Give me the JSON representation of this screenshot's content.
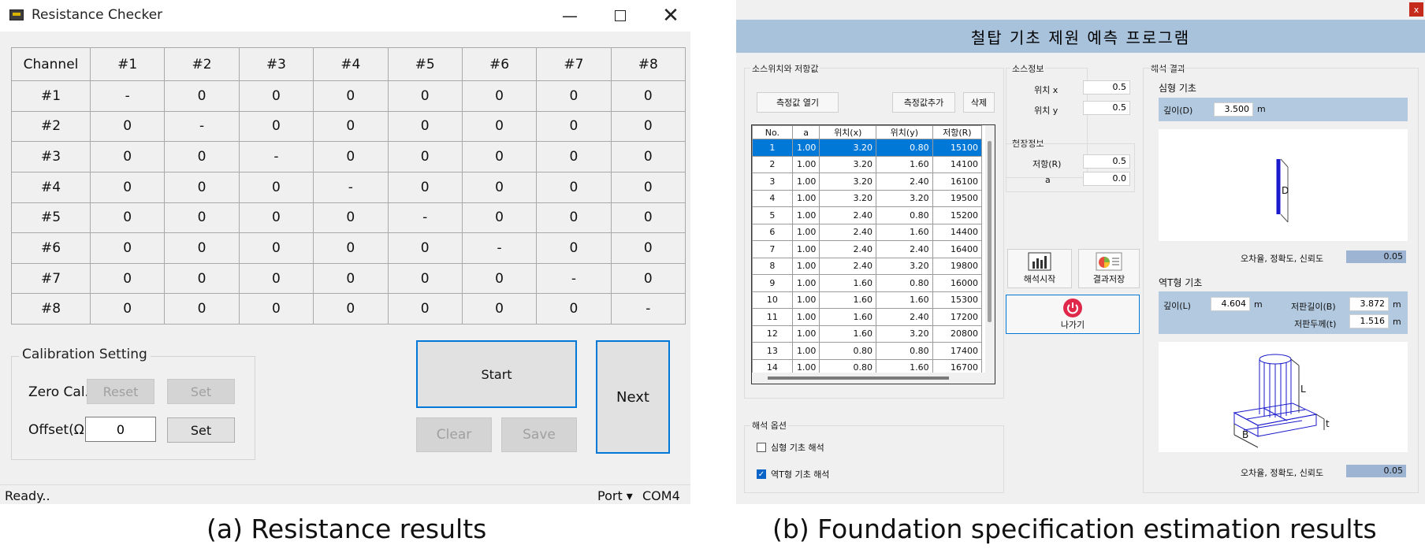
{
  "left": {
    "title": "Resistance Checker",
    "grid": {
      "headers": [
        "Channel",
        "#1",
        "#2",
        "#3",
        "#4",
        "#5",
        "#6",
        "#7",
        "#8"
      ],
      "rows": [
        [
          "#1",
          "-",
          "0",
          "0",
          "0",
          "0",
          "0",
          "0",
          "0"
        ],
        [
          "#2",
          "0",
          "-",
          "0",
          "0",
          "0",
          "0",
          "0",
          "0"
        ],
        [
          "#3",
          "0",
          "0",
          "-",
          "0",
          "0",
          "0",
          "0",
          "0"
        ],
        [
          "#4",
          "0",
          "0",
          "0",
          "-",
          "0",
          "0",
          "0",
          "0"
        ],
        [
          "#5",
          "0",
          "0",
          "0",
          "0",
          "-",
          "0",
          "0",
          "0"
        ],
        [
          "#6",
          "0",
          "0",
          "0",
          "0",
          "0",
          "-",
          "0",
          "0"
        ],
        [
          "#7",
          "0",
          "0",
          "0",
          "0",
          "0",
          "0",
          "-",
          "0"
        ],
        [
          "#8",
          "0",
          "0",
          "0",
          "0",
          "0",
          "0",
          "0",
          "-"
        ]
      ]
    },
    "calibration": {
      "title": "Calibration Setting",
      "zero_label": "Zero Cal.",
      "reset_label": "Reset",
      "set_label": "Set",
      "offset_label": "Offset(Ω)",
      "offset_value": "0",
      "offset_set_label": "Set"
    },
    "start_label": "Start",
    "clear_label": "Clear",
    "save_label": "Save",
    "next_label": "Next",
    "status": "Ready..",
    "port_label": "Port ▾",
    "port_value": "COM4"
  },
  "right": {
    "title": "철탑 기초 제원 예측 프로그램",
    "close_label": "x",
    "src_group": "소스위치와 저항값",
    "open_btn": "측정값 열기",
    "add_btn": "측정값추가",
    "del_btn": "삭제",
    "table_headers": [
      "No.",
      "a",
      "위치(x)",
      "위치(y)",
      "저항(R)"
    ],
    "table_rows": [
      [
        "1",
        "1.00",
        "3.20",
        "0.80",
        "15100"
      ],
      [
        "2",
        "1.00",
        "3.20",
        "1.60",
        "14100"
      ],
      [
        "3",
        "1.00",
        "3.20",
        "2.40",
        "16100"
      ],
      [
        "4",
        "1.00",
        "3.20",
        "3.20",
        "19500"
      ],
      [
        "5",
        "1.00",
        "2.40",
        "0.80",
        "15200"
      ],
      [
        "6",
        "1.00",
        "2.40",
        "1.60",
        "14400"
      ],
      [
        "7",
        "1.00",
        "2.40",
        "2.40",
        "16400"
      ],
      [
        "8",
        "1.00",
        "2.40",
        "3.20",
        "19800"
      ],
      [
        "9",
        "1.00",
        "1.60",
        "0.80",
        "16000"
      ],
      [
        "10",
        "1.00",
        "1.60",
        "1.60",
        "15300"
      ],
      [
        "11",
        "1.00",
        "1.60",
        "2.40",
        "17200"
      ],
      [
        "12",
        "1.00",
        "1.60",
        "3.20",
        "20800"
      ],
      [
        "13",
        "1.00",
        "0.80",
        "0.80",
        "17400"
      ],
      [
        "14",
        "1.00",
        "0.80",
        "1.60",
        "16700"
      ]
    ],
    "source_info": "소스정보",
    "pos_x_label": "위치 x",
    "pos_x": "0.5",
    "pos_y_label": "위치 y",
    "pos_y": "0.5",
    "field_info": "현장정보",
    "resist_label": "저항(R)",
    "resist": "0.5",
    "a_label": "a",
    "a_value": "0.0",
    "analyze_btn": "해석시작",
    "save_btn": "결과저장",
    "exit_btn": "나가기",
    "options_title": "해석 옵션",
    "opt1": "심형 기초 해석",
    "opt2": "역T형 기초 해석",
    "results_title": "해석 결과",
    "deep_title": "심형 기초",
    "depth_label": "깊이(D)",
    "depth_value": "3.500",
    "unit_m": "m",
    "dim_d": "D",
    "err_label1": "오차율, 정확도, 신뢰도",
    "err_value1": "0.05",
    "invt_title": "역T형 기초",
    "depth_l_label": "깊이(L)",
    "depth_l_value": "4.604",
    "slab_len_label": "저판길이(B)",
    "slab_len_value": "3.872",
    "slab_thk_label": "저판두께(t)",
    "slab_thk_value": "1.516",
    "dim_l": "L",
    "dim_t": "t",
    "dim_b": "B",
    "err_label2": "오차율, 정확도, 신뢰도",
    "err_value2": "0.05"
  },
  "captions": {
    "a": "(a) Resistance results",
    "b": "(b) Foundation specification estimation results"
  }
}
